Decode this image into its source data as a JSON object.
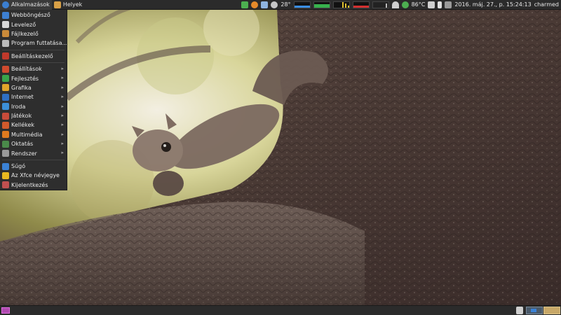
{
  "top_panel": {
    "applications_label": "Alkalmazások",
    "places_label": "Helyek",
    "weather_temp": "28°",
    "cpu_temp": "86°C",
    "clock": "2016. máj. 27., p. 15:24:13",
    "username": "charmed"
  },
  "app_menu": {
    "items": [
      {
        "label": "Webböngésző",
        "icon": "web-browser-icon",
        "color": "#3d7fd1"
      },
      {
        "label": "Levelező",
        "icon": "mail-icon",
        "color": "#d8d8d8"
      },
      {
        "label": "Fájlkezelő",
        "icon": "file-manager-icon",
        "color": "#c98a3a"
      },
      {
        "label": "Program futtatása...",
        "icon": "run-program-icon",
        "color": "#bbbbbb"
      },
      {
        "label": "Beállításkezelő",
        "icon": "settings-manager-icon",
        "color": "#c0392b"
      },
      {
        "label": "Beállítások",
        "icon": "settings-icon",
        "color": "#d04a2e",
        "submenu": true
      },
      {
        "label": "Fejlesztés",
        "icon": "development-icon",
        "color": "#3aa34a",
        "submenu": true
      },
      {
        "label": "Grafika",
        "icon": "graphics-icon",
        "color": "#e1a52b",
        "submenu": true
      },
      {
        "label": "Internet",
        "icon": "internet-icon",
        "color": "#2f6fc2",
        "submenu": true
      },
      {
        "label": "Iroda",
        "icon": "office-icon",
        "color": "#3c8fd8",
        "submenu": true
      },
      {
        "label": "Játékok",
        "icon": "games-icon",
        "color": "#c84b3a",
        "submenu": true
      },
      {
        "label": "Kellékek",
        "icon": "accessories-icon",
        "color": "#d25a2c",
        "submenu": true
      },
      {
        "label": "Multimédia",
        "icon": "multimedia-icon",
        "color": "#e07a1f",
        "submenu": true
      },
      {
        "label": "Oktatás",
        "icon": "education-icon",
        "color": "#4a8a4a",
        "submenu": true
      },
      {
        "label": "Rendszer",
        "icon": "system-icon",
        "color": "#9a9a9a",
        "submenu": true
      },
      {
        "label": "Súgó",
        "icon": "help-icon",
        "color": "#3b82d6"
      },
      {
        "label": "Az Xfce névjegye",
        "icon": "about-xfce-icon",
        "color": "#e8b820"
      },
      {
        "label": "Kijelentkezés",
        "icon": "logout-icon",
        "color": "#c05050"
      }
    ]
  }
}
